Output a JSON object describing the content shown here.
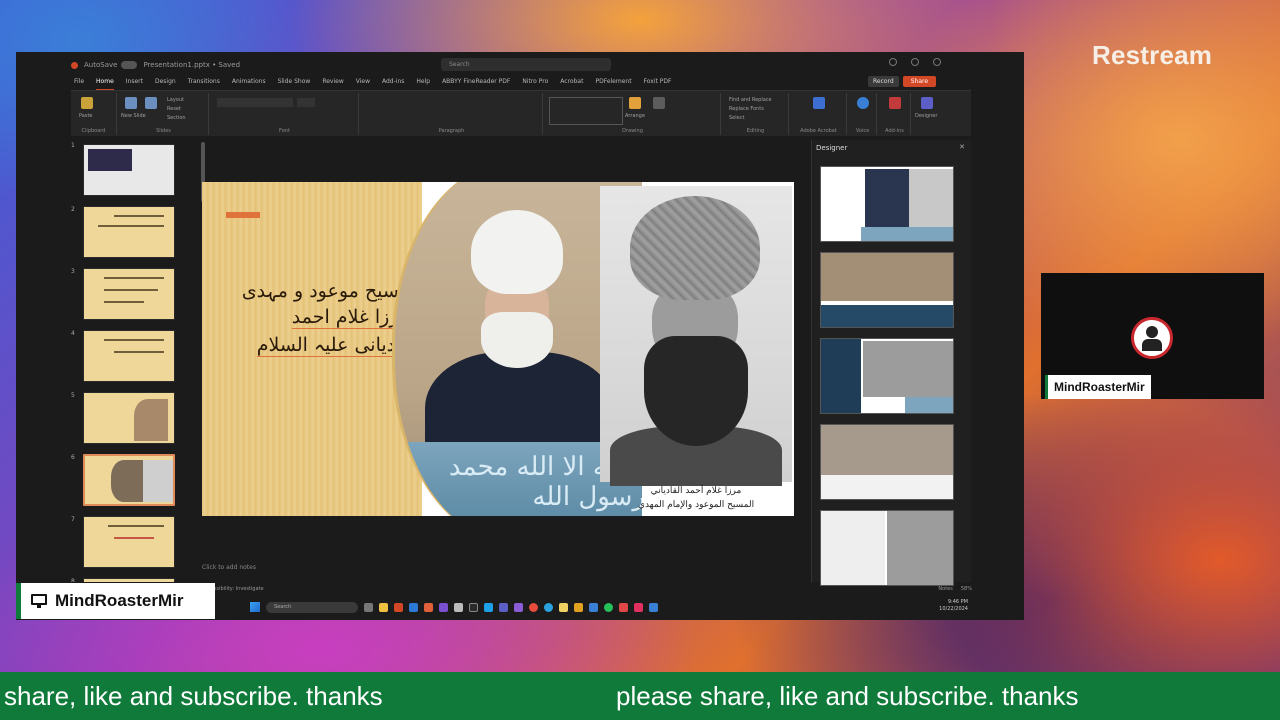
{
  "stream": {
    "brand": "Restream",
    "presenter_name": "MindRoasterMir",
    "guest_name": "MindRoasterMir",
    "ticker_left": "share, like and subscribe. thanks",
    "ticker_right": "please share, like and subscribe. thanks"
  },
  "app": {
    "autosave": "AutoSave",
    "filename": "Presentation1.pptx • Saved",
    "search_placeholder": "Search",
    "record_label": "Record",
    "share_label": "Share",
    "menu": [
      "File",
      "Home",
      "Insert",
      "Design",
      "Transitions",
      "Animations",
      "Slide Show",
      "Review",
      "View",
      "Add-ins",
      "Help",
      "ABBYY FineReader PDF",
      "Nitro Pro",
      "Acrobat",
      "PDFelement",
      "Foxit PDF"
    ],
    "active_menu": "Home",
    "ribbon_groups": [
      "Clipboard",
      "Slides",
      "Font",
      "Paragraph",
      "Drawing",
      "Editing",
      "Adobe Acrobat",
      "Voice",
      "Add-ins"
    ],
    "ribbon_buttons": {
      "paste": "Paste",
      "new_slide": "New Slide",
      "reuse_slides": "Reuse Slides",
      "layout": "Layout",
      "reset": "Reset",
      "section": "Section",
      "arrange": "Arrange",
      "quick_styles": "Quick Styles",
      "find_replace": "Find and Replace",
      "replace_fonts": "Replace Fonts",
      "select": "Select",
      "create_share": "Create and Share Adobe PDF",
      "dictate": "Dictate",
      "add_ins": "Add-ins",
      "designer": "Designer"
    },
    "thumbnail_numbers": [
      "1",
      "2",
      "3",
      "4",
      "5",
      "6",
      "7",
      "8"
    ],
    "notes_placeholder": "Click to add notes",
    "status_left": "Accessibility: Investigate",
    "status_notes": "Notes",
    "zoom": "58%",
    "designer_title": "Designer",
    "taskbar_search": "Search",
    "clock_time": "9:46 PM",
    "clock_date": "10/22/2024"
  },
  "slide": {
    "line1": "مسیح موعود و مہدی",
    "line2": "مرزا غلام احمد",
    "line3": "قادیانی علیہ السلام",
    "caption1": "مرزا غلام أحمد القادياني",
    "caption2": "المسيح الموعود والإمام المهدي",
    "lectern_text": "لا اله الا الله محمد رسول الله"
  },
  "colors": {
    "ticker_green": "#0f7a3a",
    "slide_accent": "#e0733b",
    "office_red": "#d24726"
  }
}
